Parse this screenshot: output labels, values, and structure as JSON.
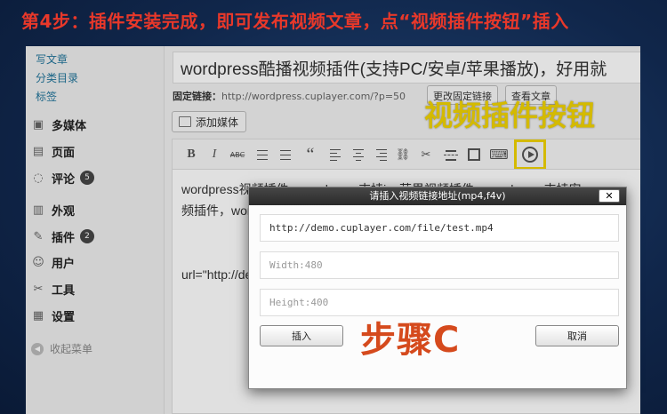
{
  "slide": {
    "title": "第4步：插件安装完成，即可发布视频文章，点“视频插件按钮”插入"
  },
  "sidebar": {
    "sub_links": [
      "写文章",
      "分类目录",
      "标签"
    ],
    "menu": [
      {
        "label": "多媒体",
        "icon": "media-icon"
      },
      {
        "label": "页面",
        "icon": "page-icon"
      },
      {
        "label": "评论",
        "icon": "comment-icon",
        "badge": "5"
      },
      {
        "label": "外观",
        "icon": "appearance-icon"
      },
      {
        "label": "插件",
        "icon": "plugin-icon",
        "badge": "2"
      },
      {
        "label": "用户",
        "icon": "users-icon"
      },
      {
        "label": "工具",
        "icon": "tools-icon"
      },
      {
        "label": "设置",
        "icon": "settings-icon"
      }
    ],
    "collapse_label": "收起菜单"
  },
  "editor": {
    "post_title": "wordpress酷播视频插件(支持PC/安卓/苹果播放)，好用就",
    "permalink_label": "固定链接：",
    "permalink_url": "http://wordpress.cuplayer.com/?p=50",
    "change_permalink": "更改固定链接",
    "view_post": "查看文章",
    "add_media": "添加媒体",
    "toolbar_b": "B",
    "toolbar_i": "I",
    "toolbar_abc": "ABC",
    "toolbar_quote": "“",
    "content_line1": "wordpress视频插件，wordpress支持ios苹果视频插件，wordpress支持安",
    "content_line2": "频插件，wordpress支持android安卓的视频插件，wordpress的视频插件什么",
    "content_line3": "url=\"http://demo.cuplayer.com/file/test.mp4\""
  },
  "callout": {
    "video_button": "视频插件按钮"
  },
  "dialog": {
    "title": "请插入视频链接地址(mp4,f4v)",
    "close": "✕",
    "url_value": "http://demo.cuplayer.com/file/test.mp4",
    "width_placeholder": "Width:480",
    "height_placeholder": "Height:400",
    "insert": "插入",
    "cancel": "取消"
  },
  "step_label": "步骤C",
  "colors": {
    "slide_title": "#e8382a",
    "callout": "#f2d400",
    "step_label": "#d54a1d",
    "link": "#21759b"
  }
}
